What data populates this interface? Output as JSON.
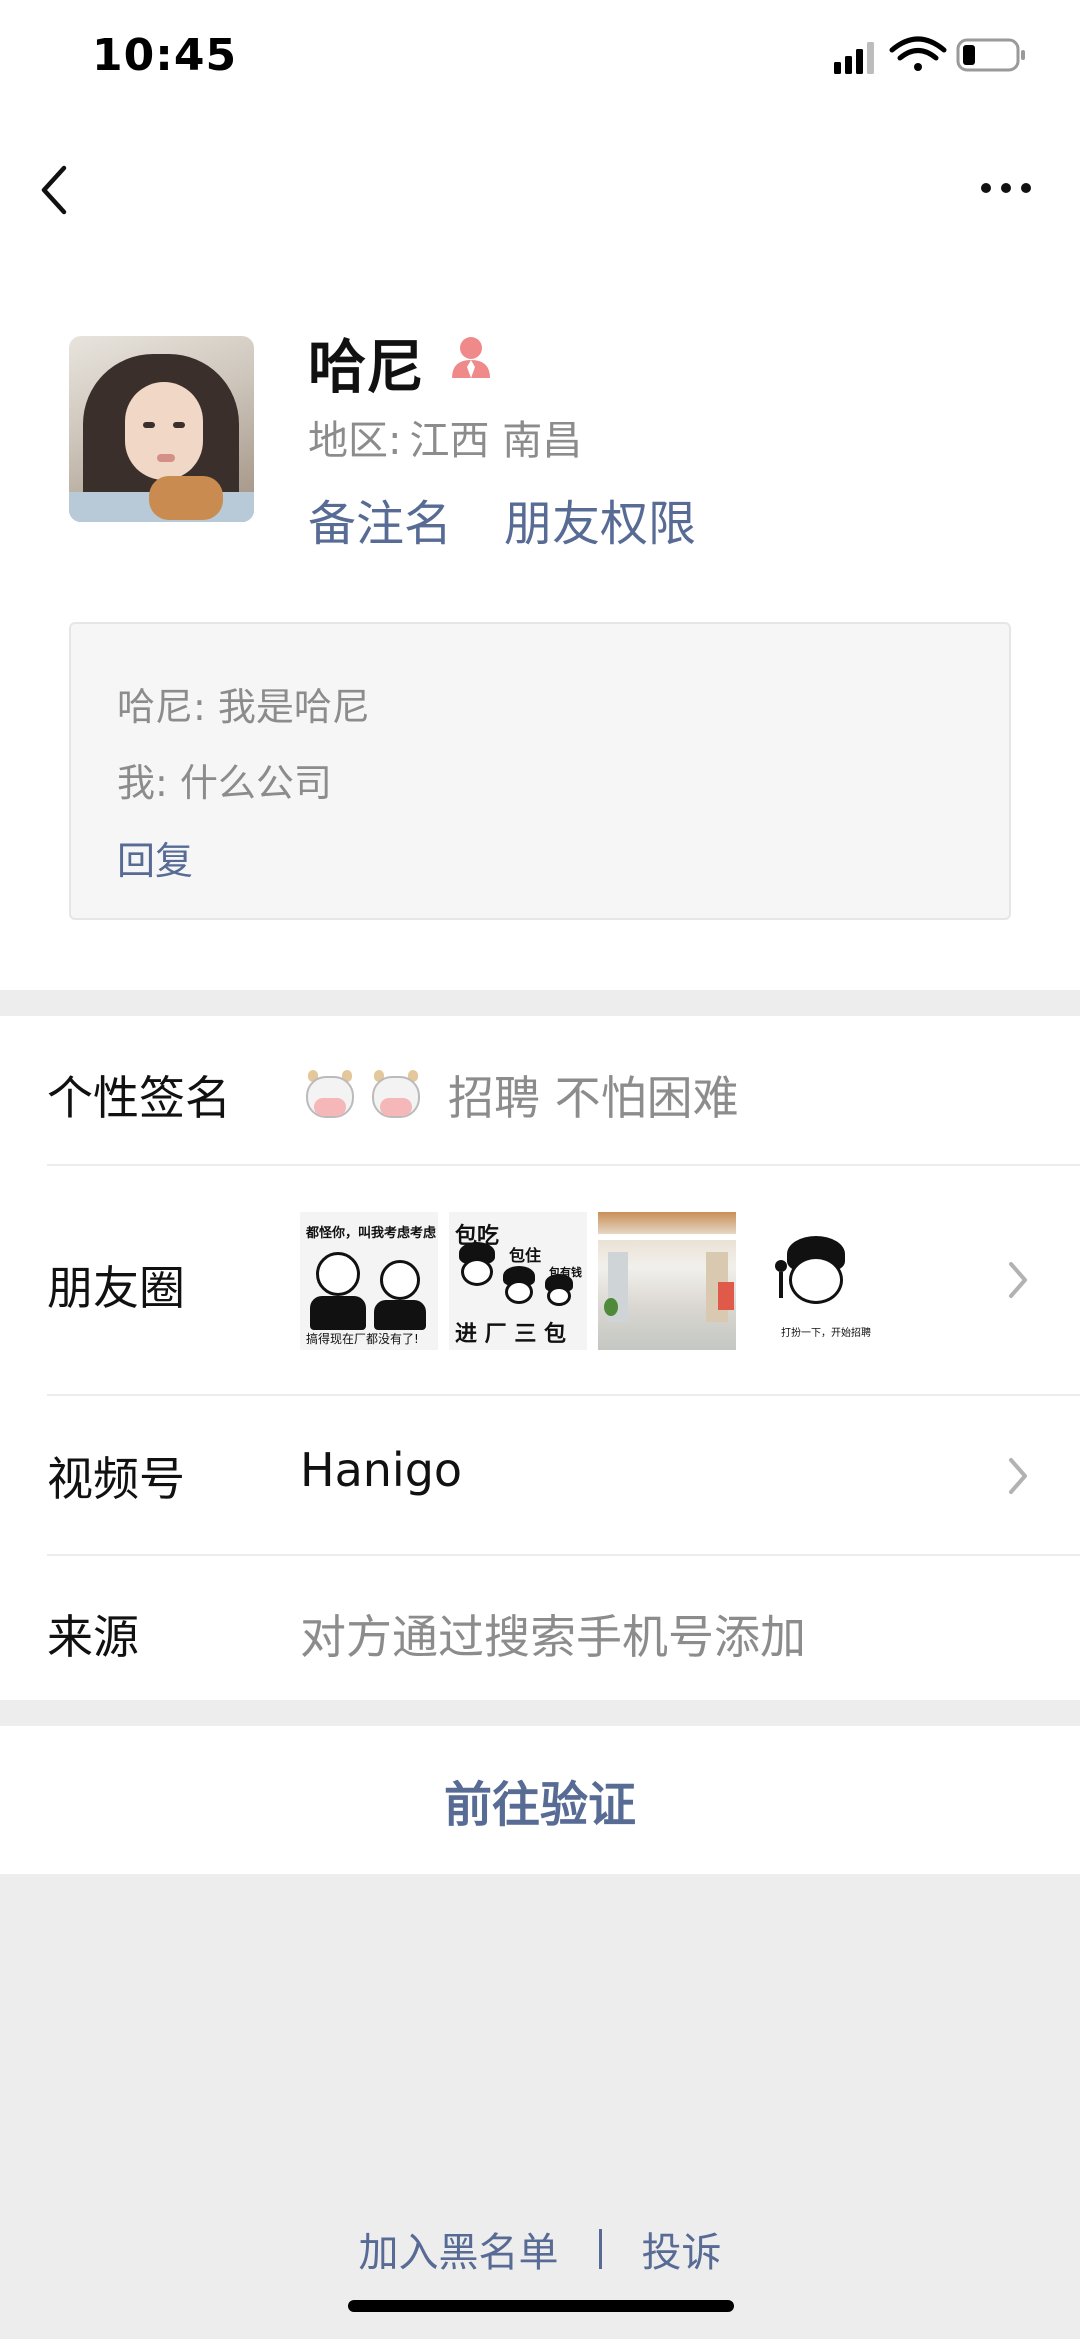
{
  "status_bar": {
    "time": "10:45"
  },
  "nav": {
    "back_icon": "chevron-left-icon",
    "more_icon": "more-dots-icon"
  },
  "profile": {
    "name": "哈尼",
    "gender_icon": "female-user-icon",
    "region_label": "地区:",
    "region_value": "江西 南昌",
    "remark_link": "备注名",
    "permission_link": "朋友权限"
  },
  "messages": {
    "lines": [
      "哈尼: 我是哈尼",
      "我: 什么公司"
    ],
    "reply_link": "回复"
  },
  "info": {
    "signature_label": "个性签名",
    "signature_emoji": [
      "cow-face-emoji",
      "cow-face-emoji"
    ],
    "signature_text": "招聘 不怕困难",
    "moments_label": "朋友圈",
    "moments_thumbs": [
      {
        "caption_top": "都怪你，叫我考虑考虑",
        "caption_bottom": "搞得现在厂都没有了!"
      },
      {
        "caption_top": "包吃",
        "caption_mid": "包住",
        "caption_side": "包有钱",
        "caption_bottom": "进 厂 三 包"
      },
      {
        "caption_top": "",
        "caption_bottom": ""
      },
      {
        "caption_top": "",
        "caption_bottom": "打扮一下，开始招聘"
      }
    ],
    "channel_label": "视频号",
    "channel_value": "Hanigo",
    "source_label": "来源",
    "source_value": "对方通过搜索手机号添加"
  },
  "verify_button": "前往验证",
  "footer": {
    "blacklist": "加入黑名单",
    "complain": "投诉"
  },
  "colors": {
    "link": "#576b95",
    "secondary_text": "#8c8c8c",
    "background": "#ededed"
  }
}
